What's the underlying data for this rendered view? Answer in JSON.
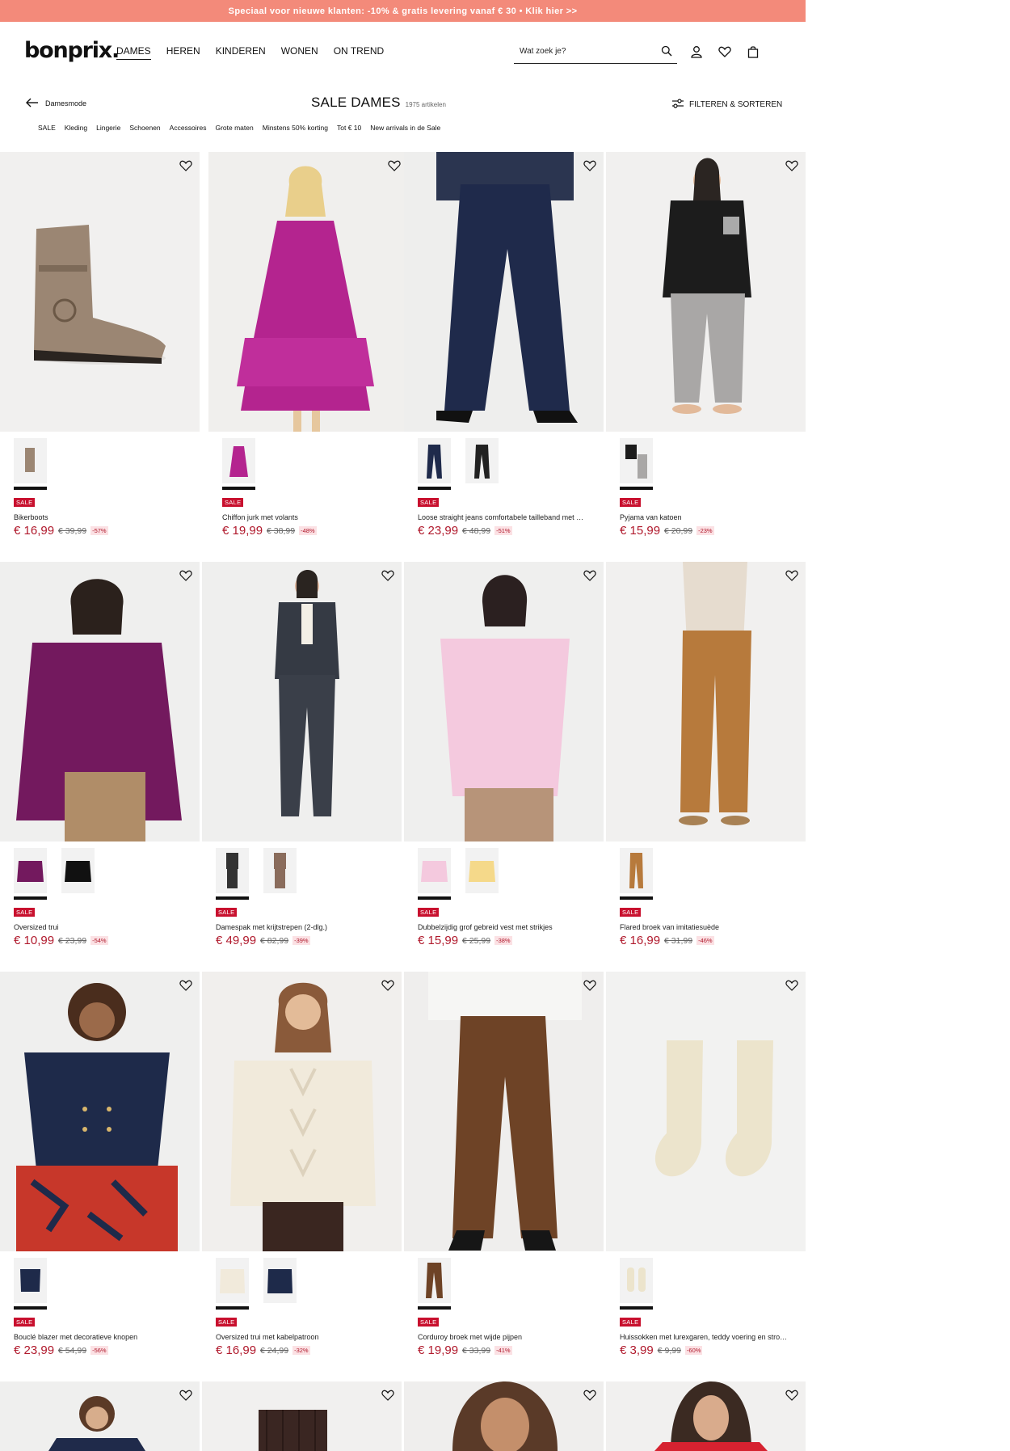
{
  "promo": {
    "text": "Speciaal voor nieuwe klanten: -10% & gratis levering vanaf € 30 • Klik hier >>"
  },
  "header": {
    "logo": "bonprix.",
    "nav": [
      "DAMES",
      "HEREN",
      "KINDEREN",
      "WONEN",
      "ON TREND"
    ],
    "search_placeholder": "Wat zoek je?"
  },
  "toolbar": {
    "back_label": "Damesmode",
    "title": "SALE DAMES",
    "count": "1975 artikelen",
    "filter_label": "FILTEREN & SORTEREN",
    "categories": [
      "SALE",
      "Kleding",
      "Lingerie",
      "Schoenen",
      "Accessoires",
      "Grote maten",
      "Minstens 50% korting",
      "Tot € 10",
      "New arrivals in de Sale"
    ]
  },
  "colors": {
    "promo_bar": "#f38a7a",
    "sale_red": "#c8102e",
    "price_red": "#b0192c"
  },
  "products": [
    {
      "badge": "SALE",
      "name": "Bikerboots",
      "price": "€ 16,99",
      "old_price": "€ 39,99",
      "discount": "-57%"
    },
    {
      "badge": "SALE",
      "name": "Chiffon jurk met volants",
      "price": "€ 19,99",
      "old_price": "€ 38,99",
      "discount": "-48%"
    },
    {
      "badge": "SALE",
      "name": "Loose straight jeans comfortabele tailleband met …",
      "price": "€ 23,99",
      "old_price": "€ 48,99",
      "discount": "-51%"
    },
    {
      "badge": "SALE",
      "name": "Pyjama van katoen",
      "price": "€ 15,99",
      "old_price": "€ 20,99",
      "discount": "-23%"
    },
    {
      "badge": "SALE",
      "name": "Oversized trui",
      "price": "€ 10,99",
      "old_price": "€ 23,99",
      "discount": "-54%"
    },
    {
      "badge": "SALE",
      "name": "Damespak met krijtstrepen (2-dlg.)",
      "price": "€ 49,99",
      "old_price": "€ 82,99",
      "discount": "-39%"
    },
    {
      "badge": "SALE",
      "name": "Dubbelzijdig grof gebreid vest met strikjes",
      "price": "€ 15,99",
      "old_price": "€ 25,99",
      "discount": "-38%"
    },
    {
      "badge": "SALE",
      "name": "Flared broek van imitatiesuède",
      "price": "€ 16,99",
      "old_price": "€ 31,99",
      "discount": "-46%"
    },
    {
      "badge": "SALE",
      "name": "Bouclé blazer met decoratieve knopen",
      "price": "€ 23,99",
      "old_price": "€ 54,99",
      "discount": "-56%"
    },
    {
      "badge": "SALE",
      "name": "Oversized trui met kabelpatroon",
      "price": "€ 16,99",
      "old_price": "€ 24,99",
      "discount": "-32%"
    },
    {
      "badge": "SALE",
      "name": "Corduroy broek met wijde pijpen",
      "price": "€ 19,99",
      "old_price": "€ 33,99",
      "discount": "-41%"
    },
    {
      "badge": "SALE",
      "name": "Huissokken met lurexgaren, teddy voering en stro…",
      "price": "€ 3,99",
      "old_price": "€ 9,99",
      "discount": "-60%"
    }
  ]
}
